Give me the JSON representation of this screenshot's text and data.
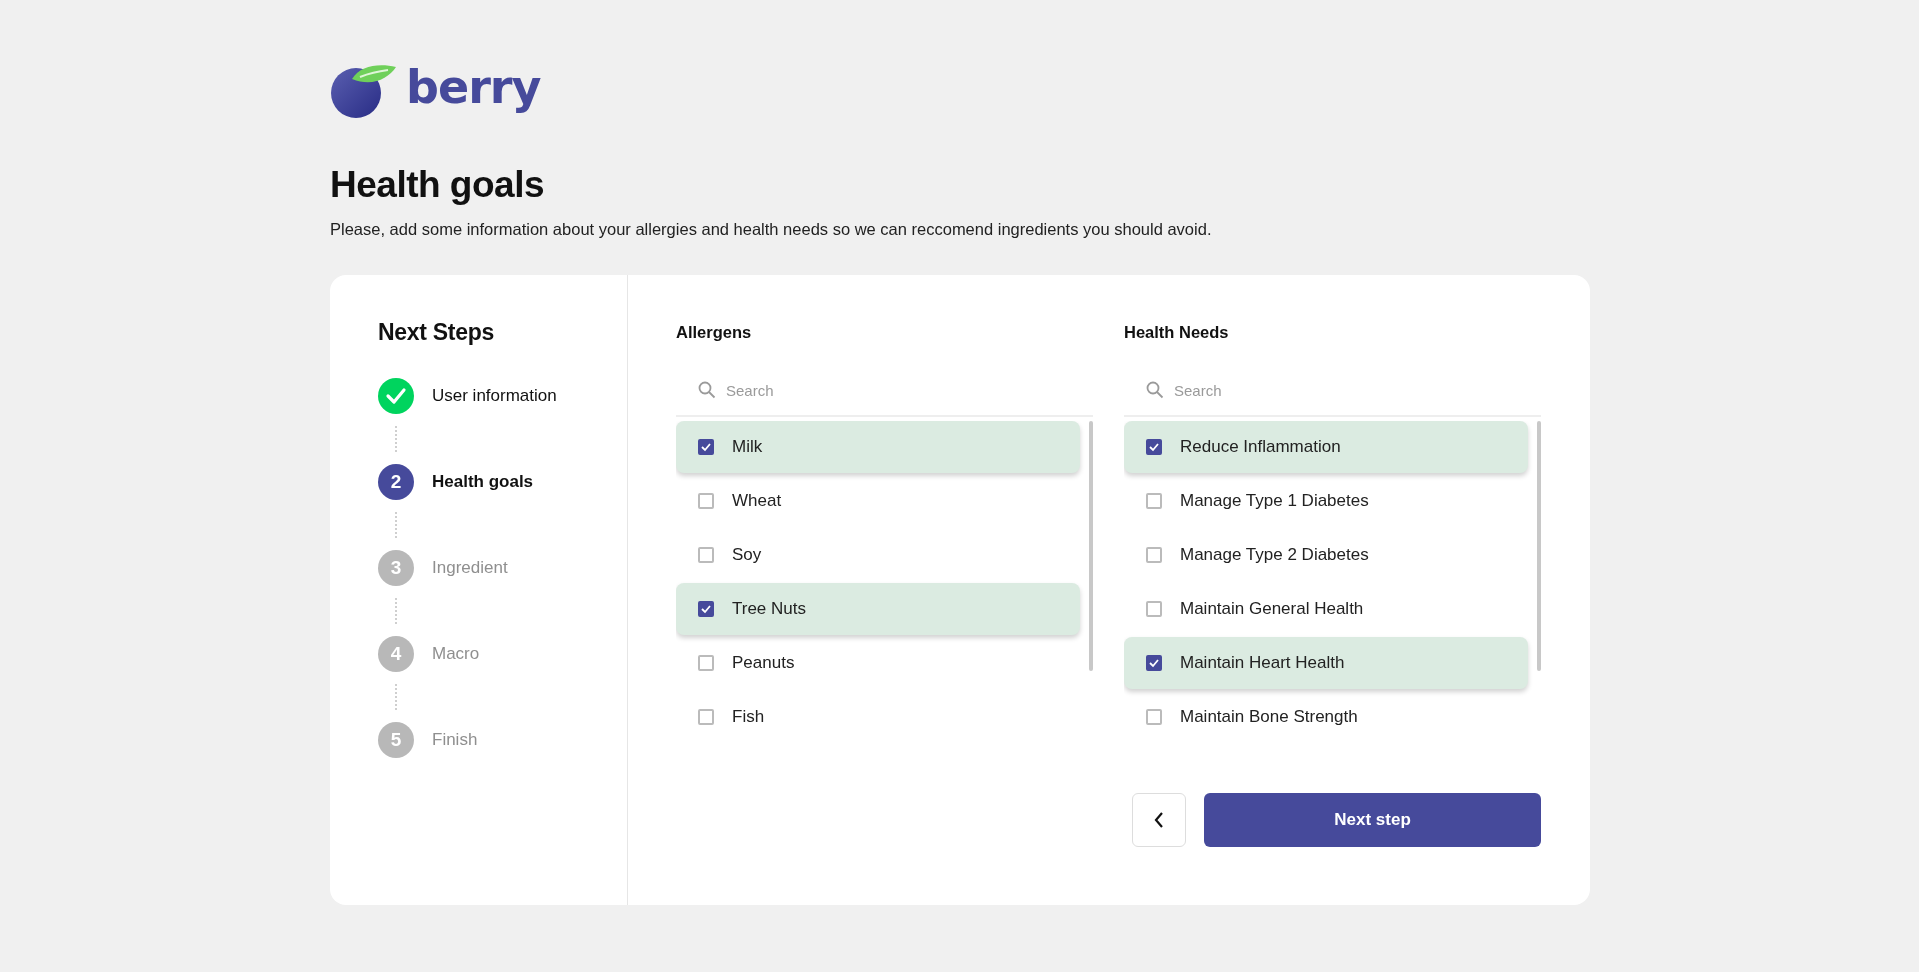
{
  "logo": {
    "text": "berry"
  },
  "page": {
    "title": "Health goals",
    "subtitle": "Please, add some information about your allergies and health needs so we can reccomend ingredients you should avoid."
  },
  "steps": {
    "title": "Next Steps",
    "items": [
      {
        "label": "User information",
        "completed": true,
        "selected": false
      },
      {
        "number": "2",
        "label": "Health goals",
        "completed": false,
        "selected": true
      },
      {
        "number": "3",
        "label": "Ingredient",
        "completed": false,
        "selected": false
      },
      {
        "number": "4",
        "label": "Macro",
        "completed": false,
        "selected": false
      },
      {
        "number": "5",
        "label": "Finish",
        "completed": false,
        "selected": false
      }
    ]
  },
  "lists": [
    {
      "title": "Allergens",
      "search": {
        "placeholder": "Search"
      },
      "items": [
        {
          "label": "Milk",
          "checked": true
        },
        {
          "label": "Wheat",
          "checked": false
        },
        {
          "label": "Soy",
          "checked": false
        },
        {
          "label": "Tree Nuts",
          "checked": true
        },
        {
          "label": "Peanuts",
          "checked": false
        },
        {
          "label": "Fish",
          "checked": false
        }
      ]
    },
    {
      "title": "Health Needs",
      "search": {
        "placeholder": "Search"
      },
      "items": [
        {
          "label": "Reduce Inflammation",
          "checked": true
        },
        {
          "label": "Manage Type 1 Diabetes",
          "checked": false
        },
        {
          "label": "Manage Type 2 Diabetes",
          "checked": false
        },
        {
          "label": "Maintain General Health",
          "checked": false
        },
        {
          "label": "Maintain Heart Health",
          "checked": true
        },
        {
          "label": "Maintain Bone Strength",
          "checked": false
        }
      ]
    }
  ],
  "buttons": {
    "next": "Next step"
  }
}
